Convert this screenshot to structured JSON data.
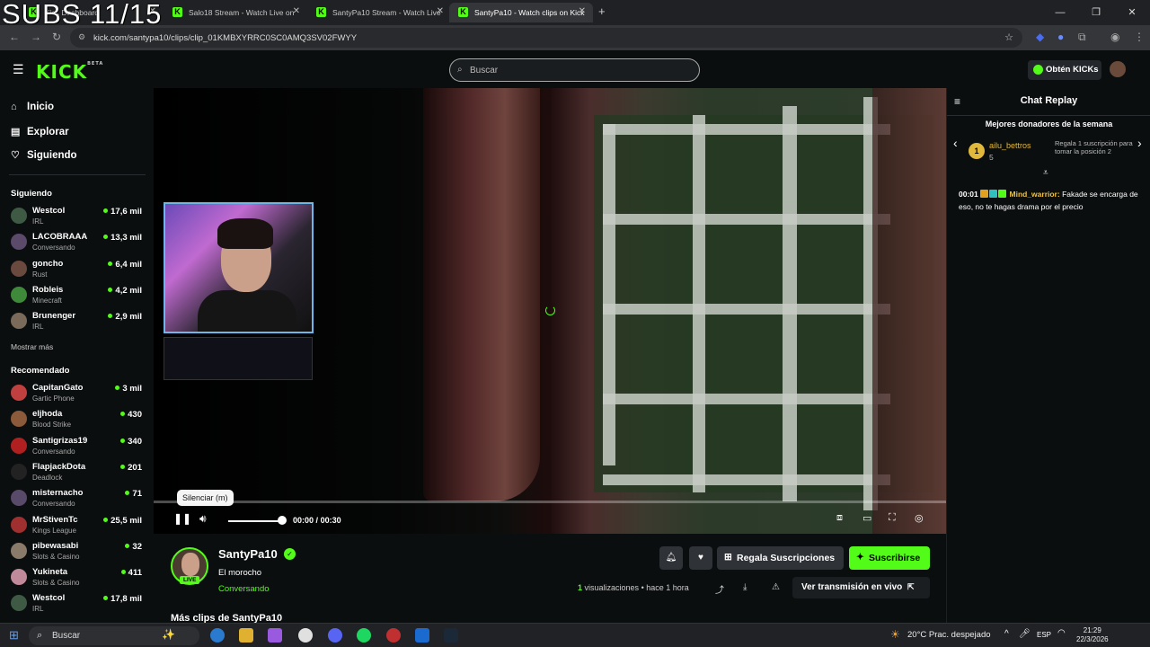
{
  "overlay_text": "SUBS 11/15",
  "browser": {
    "tabs": [
      {
        "label": "Kick Dashboard",
        "active": false
      },
      {
        "label": "Salo18 Stream - Watch Live on",
        "active": false
      },
      {
        "label": "SantyPa10 Stream - Watch Live",
        "active": false
      },
      {
        "label": "SantyPa10 - Watch clips on Kick",
        "active": true
      }
    ],
    "new_tab": "+",
    "url": "kick.com/santypa10/clips/clip_01KMBXYRRC0SC0AMQ3SV02FWYY",
    "window_controls": [
      "—",
      "❐",
      "✕"
    ]
  },
  "header": {
    "logo": "KICK",
    "logo_sup": "BETA",
    "search_placeholder": "Buscar",
    "kicks_label": "Obtén KICKs"
  },
  "sidebar": {
    "nav": [
      {
        "label": "Inicio",
        "icon": "home-icon"
      },
      {
        "label": "Explorar",
        "icon": "browse-icon"
      },
      {
        "label": "Siguiendo",
        "icon": "heart-icon"
      }
    ],
    "following_title": "Siguiendo",
    "following": [
      {
        "name": "Westcol",
        "category": "IRL",
        "viewers": "17,6 mil",
        "color": "#3e5a44"
      },
      {
        "name": "LACOBRAAA",
        "category": "Conversando",
        "viewers": "13,3 mil",
        "color": "#5b4a6a"
      },
      {
        "name": "goncho",
        "category": "Rust",
        "viewers": "6,4 mil",
        "color": "#6a4a3e"
      },
      {
        "name": "Robleis",
        "category": "Minecraft",
        "viewers": "4,2 mil",
        "color": "#3f8a3a"
      },
      {
        "name": "Brunenger",
        "category": "IRL",
        "viewers": "2,9 mil",
        "color": "#7a6a5a"
      }
    ],
    "show_more": "Mostrar más",
    "recommended_title": "Recomendado",
    "recommended": [
      {
        "name": "CapitanGato",
        "category": "Gartic Phone",
        "viewers": "3 mil",
        "color": "#c04040"
      },
      {
        "name": "eljhoda",
        "category": "Blood Strike",
        "viewers": "430",
        "color": "#8a5a3a"
      },
      {
        "name": "Santigrizas19",
        "category": "Conversando",
        "viewers": "340",
        "color": "#b02020"
      },
      {
        "name": "FlapjackDota",
        "category": "Deadlock",
        "viewers": "201",
        "color": "#222222"
      },
      {
        "name": "misternacho",
        "category": "Conversando",
        "viewers": "71",
        "color": "#5a4a6a"
      },
      {
        "name": "MrStivenTc",
        "category": "Kings League",
        "viewers": "25,5 mil",
        "color": "#a03030"
      },
      {
        "name": "pibewasabi",
        "category": "Slots & Casino",
        "viewers": "32",
        "color": "#8a7a6a"
      },
      {
        "name": "Yukineta",
        "category": "Slots & Casino",
        "viewers": "411",
        "color": "#c08a9a"
      },
      {
        "name": "Westcol",
        "category": "IRL",
        "viewers": "17,8 mil",
        "color": "#3e5a44"
      }
    ]
  },
  "player": {
    "tooltip": "Silenciar (m)",
    "time_current": "00:00",
    "time_separator": "/",
    "time_total": "00:30",
    "progress": 0.0,
    "volume": 1.0
  },
  "chat": {
    "title": "Chat Replay",
    "donors_title": "Mejores donadores de la semana",
    "donor": {
      "rank": "1",
      "name": "ailu_bettros",
      "count": "5"
    },
    "gift_hint": "Regala 1 suscripción para tomar la posición 2",
    "messages": [
      {
        "time": "00:01",
        "user": "Mind_warrior:",
        "text": "Fakade se encarga de eso, no te hagas drama por el precio"
      }
    ]
  },
  "channel": {
    "name": "SantyPa10",
    "live_label": "LIVE",
    "clip_title": "El morocho",
    "category": "Conversando",
    "gift_button": "Regala Suscripciones",
    "subscribe_button": "Suscribirse",
    "views_count": "1",
    "views_label": "visualizaciones",
    "time_ago": "• hace 1 hora",
    "watch_live": "Ver transmisión en vivo",
    "more_clips": "Más clips de SantyPa10"
  },
  "taskbar": {
    "search_label": "Buscar",
    "weather": "20°C  Prac. despejado",
    "lang": "ESP",
    "time": "21:29",
    "date": "22/3/2026"
  }
}
